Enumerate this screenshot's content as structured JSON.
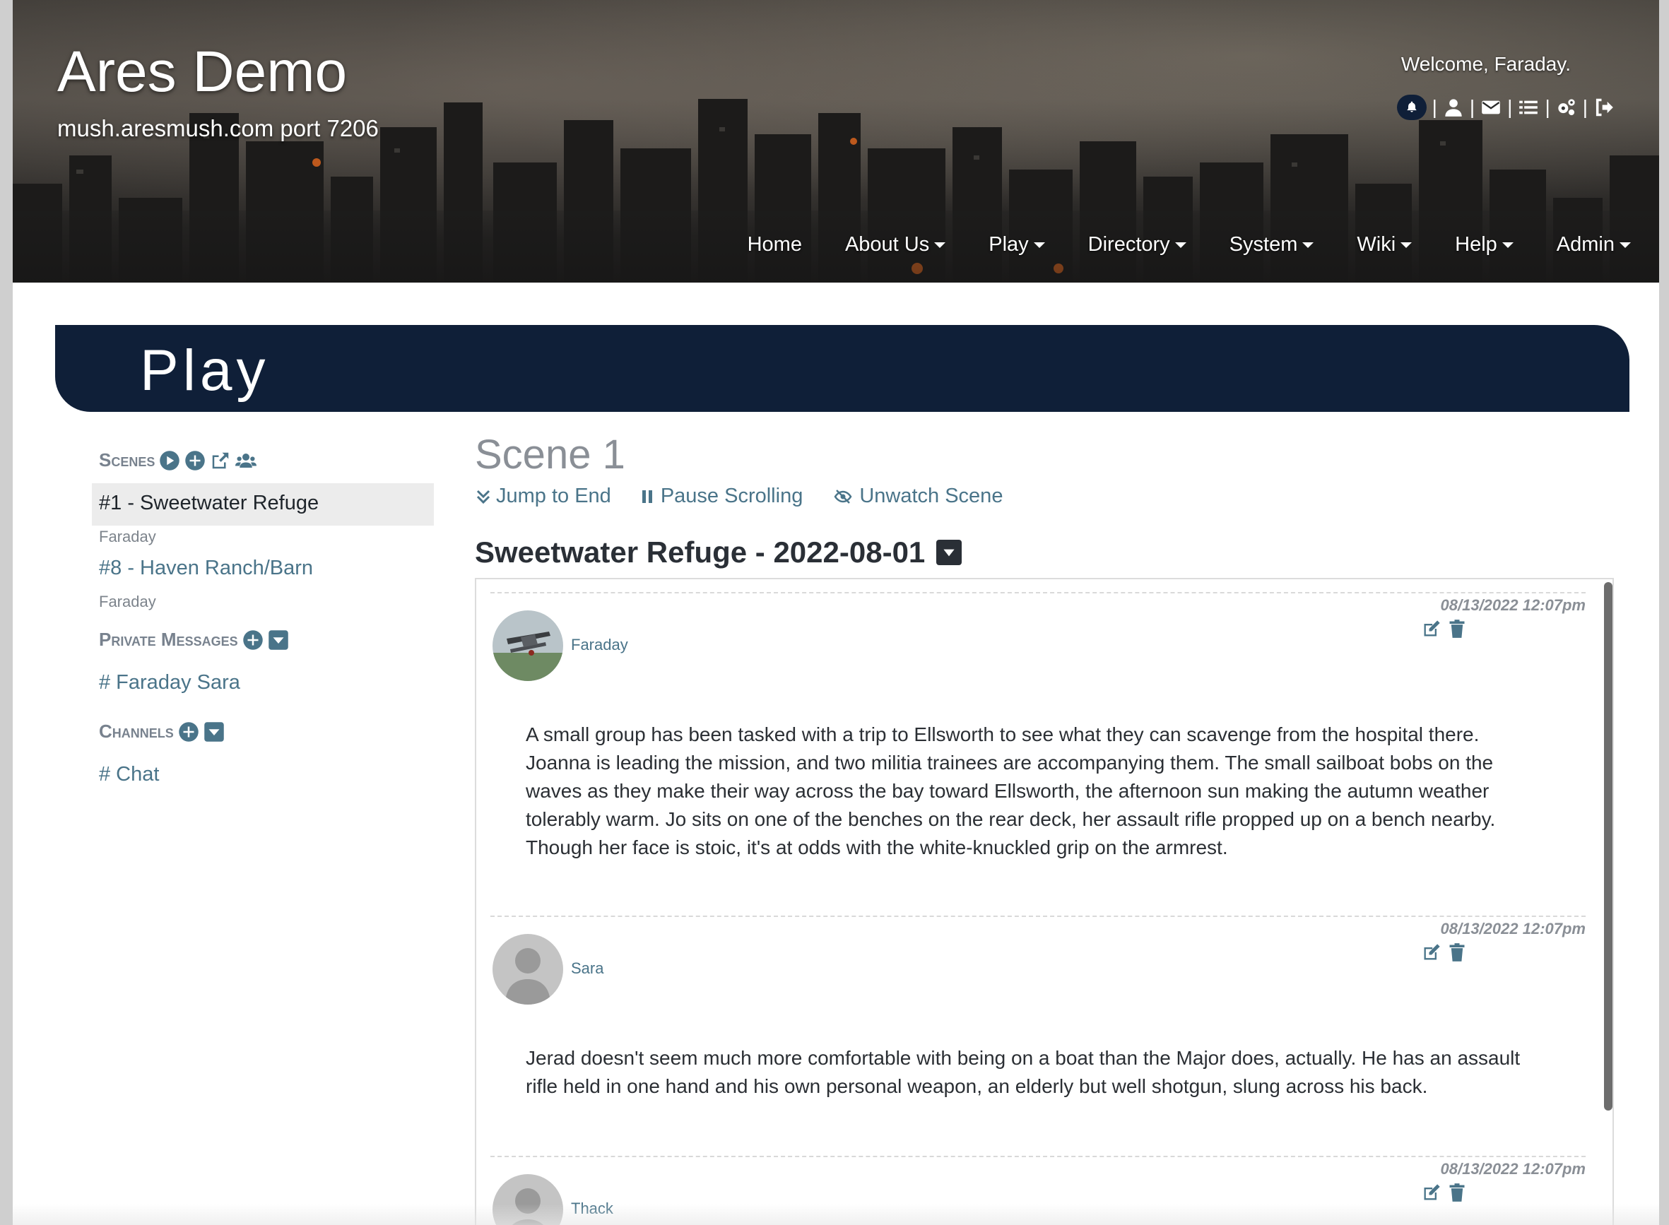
{
  "site": {
    "title": "Ares Demo",
    "subtitle": "mush.aresmush.com port 7206",
    "welcome": "Welcome, Faraday."
  },
  "user_icons": [
    "bell-icon",
    "user-icon",
    "mail-icon",
    "list-icon",
    "gears-icon",
    "logout-icon"
  ],
  "nav": [
    {
      "label": "Home",
      "dropdown": false
    },
    {
      "label": "About Us",
      "dropdown": true
    },
    {
      "label": "Play",
      "dropdown": true
    },
    {
      "label": "Directory",
      "dropdown": true
    },
    {
      "label": "System",
      "dropdown": true
    },
    {
      "label": "Wiki",
      "dropdown": true
    },
    {
      "label": "Help",
      "dropdown": true
    },
    {
      "label": "Admin",
      "dropdown": true
    }
  ],
  "banner": {
    "title": "Play"
  },
  "sidebar": {
    "scenes_heading": "Scenes",
    "scenes": [
      {
        "label": "#1 - Sweetwater Refuge",
        "owner": "Faraday",
        "active": true
      },
      {
        "label": "#8 - Haven Ranch/Barn",
        "owner": "Faraday",
        "active": false
      }
    ],
    "pm_heading": "Private Messages",
    "pms": [
      {
        "label": "# Faraday Sara"
      }
    ],
    "channels_heading": "Channels",
    "channels": [
      {
        "label": "# Chat"
      }
    ]
  },
  "main": {
    "scene_title": "Scene 1",
    "actions": {
      "jump": "Jump to End",
      "pause": "Pause Scrolling",
      "unwatch": "Unwatch Scene"
    },
    "scene_heading": "Sweetwater Refuge - 2022-08-01",
    "poses": [
      {
        "character": "Faraday",
        "timestamp": "08/13/2022 12:07pm",
        "text": "A small group has been tasked with a trip to Ellsworth to see what they can scavenge from the hospital there. Joanna is leading the mission, and two militia trainees are accompanying them. The small sailboat bobs on the waves as they make their way across the bay toward Ellsworth, the afternoon sun making the autumn weather tolerably warm. Jo sits on one of the benches on the rear deck, her assault rifle propped up on a bench nearby. Though her face is stoic, it's at odds with the white-knuckled grip on the armrest."
      },
      {
        "character": "Sara",
        "timestamp": "08/13/2022 12:07pm",
        "text": "Jerad doesn't seem much more comfortable with being on a boat than the Major does, actually. He has an assault rifle held in one hand and his own personal weapon, an elderly but well shotgun, slung across his back."
      },
      {
        "character": "Thack",
        "timestamp": "08/13/2022 12:07pm",
        "text": ""
      }
    ]
  },
  "colors": {
    "banner": "#0f1f38",
    "link": "#4a7489",
    "muted": "#78828e"
  }
}
